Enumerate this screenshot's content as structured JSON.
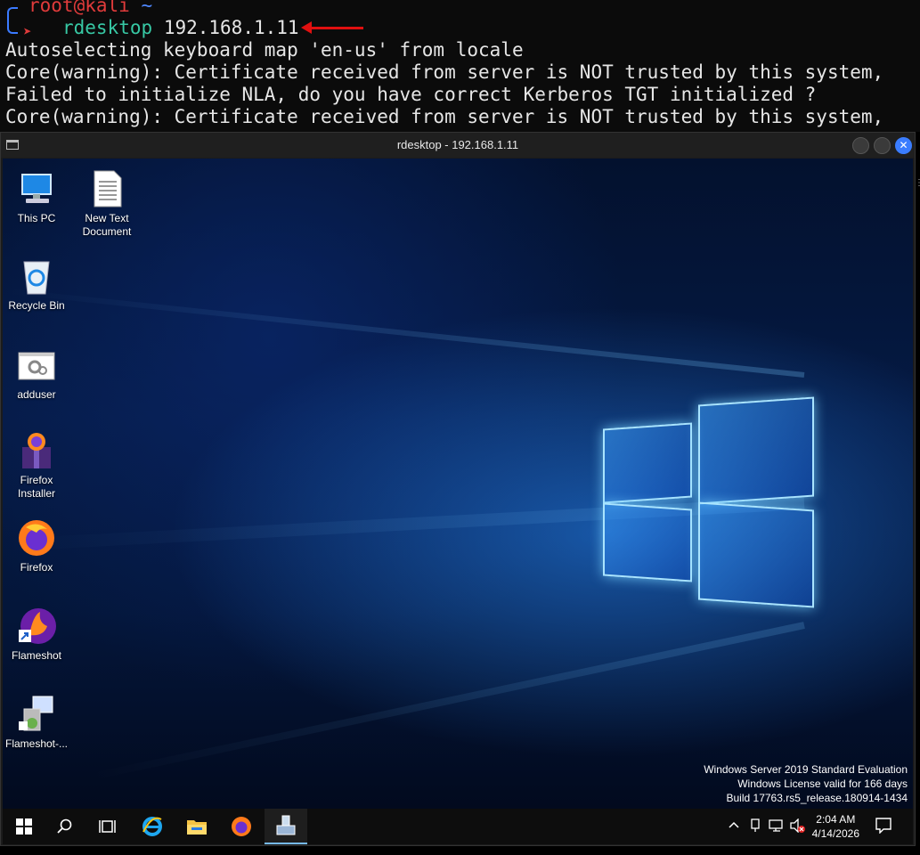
{
  "terminal": {
    "prompt_user": "root",
    "prompt_at": "@",
    "prompt_host": "kali",
    "prompt_dir": "~",
    "command": "rdesktop",
    "command_arg": "192.168.1.11",
    "lines": [
      "Autoselecting keyboard map 'en-us' from locale",
      "Core(warning): Certificate received from server is NOT trusted by this system,",
      "Failed to initialize NLA, do you have correct Kerberos TGT initialized ?",
      "Core(warning): Certificate received from server is NOT trusted by this system,"
    ]
  },
  "window": {
    "title": "rdesktop - 192.168.1.11",
    "close_glyph": "✕"
  },
  "desktop": {
    "icons": [
      {
        "label": "This PC",
        "icon": "computer-icon"
      },
      {
        "label": "New Text Document",
        "icon": "text-document-icon"
      },
      {
        "label": "Recycle Bin",
        "icon": "recycle-bin-icon"
      },
      {
        "label": "adduser",
        "icon": "settings-file-icon"
      },
      {
        "label": "Firefox Installer",
        "icon": "installer-icon"
      },
      {
        "label": "Firefox",
        "icon": "firefox-icon"
      },
      {
        "label": "Flameshot",
        "icon": "flameshot-icon"
      },
      {
        "label": "Flameshot-...",
        "icon": "setup-icon"
      }
    ],
    "watermark": {
      "line1": "Windows Server 2019 Standard Evaluation",
      "line2": "Windows License valid for 166 days",
      "line3": "Build 17763.rs5_release.180914-1434"
    }
  },
  "taskbar": {
    "items": [
      "start-icon",
      "search-icon",
      "task-view-icon",
      "internet-explorer-icon",
      "file-explorer-icon",
      "firefox-icon",
      "rdp-app-icon"
    ],
    "time": "2:04 AM",
    "date": "4/14/2026",
    "tray": [
      "chevron-up-icon",
      "usb-icon",
      "network-icon",
      "speaker-muted-icon",
      "notification-icon"
    ]
  },
  "colors": {
    "accent": "#3b7dff",
    "prompt_red": "#e03b3b",
    "command_green": "#37c8a4"
  }
}
